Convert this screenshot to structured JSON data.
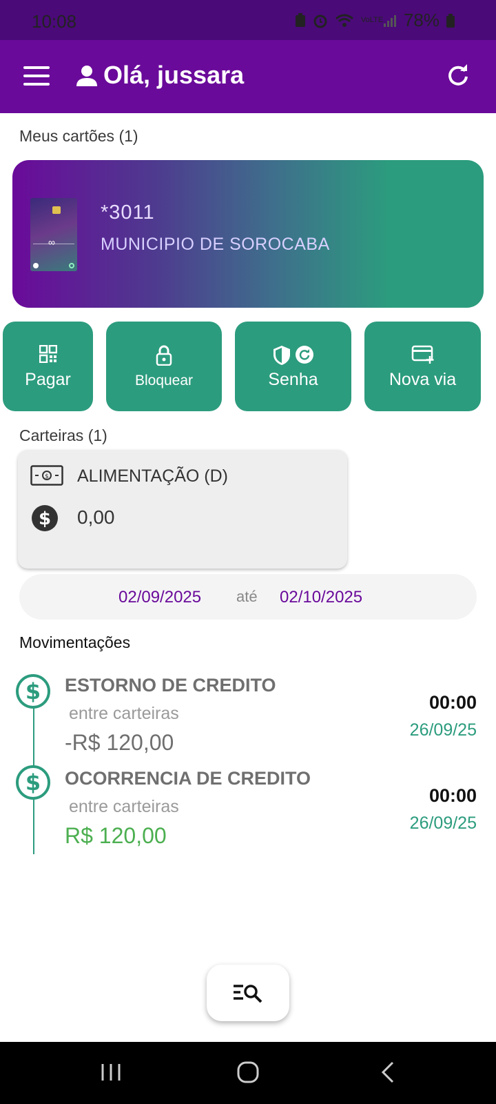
{
  "status": {
    "time": "10:08",
    "battery": "78%",
    "volte": "VoLTE"
  },
  "app_bar": {
    "greeting": "Olá, jussara"
  },
  "cards_section": {
    "label": "Meus cartões (1)"
  },
  "card": {
    "number": "*3011",
    "holder": "MUNICIPIO DE SOROCABA"
  },
  "actions": [
    {
      "label": "Pagar",
      "icon": "qr-code-icon"
    },
    {
      "label": "Bloquear",
      "icon": "lock-icon"
    },
    {
      "label": "Senha",
      "icon": "shield-refresh-icon"
    },
    {
      "label": "Nova via",
      "icon": "card-add-icon"
    }
  ],
  "wallets_section": {
    "label": "Carteiras (1)"
  },
  "wallet": {
    "name": "ALIMENTAÇÃO (D)",
    "balance": "0,00"
  },
  "date_range": {
    "start": "02/09/2025",
    "separator": "até",
    "end": "02/10/2025"
  },
  "movements_section": {
    "label": "Movimentações"
  },
  "transactions": [
    {
      "title": "ESTORNO DE  CREDITO",
      "subtitle": "entre carteiras",
      "amount": "-R$ 120,00",
      "time": "00:00",
      "date": "26/09/25"
    },
    {
      "title": "OCORRENCIA DE CREDITO",
      "subtitle": "entre carteiras",
      "amount": "R$ 120,00",
      "time": "00:00",
      "date": "26/09/25"
    }
  ],
  "colors": {
    "primary": "#6a0a9a",
    "accent": "#2c9c7e",
    "positive": "#4caf50"
  }
}
